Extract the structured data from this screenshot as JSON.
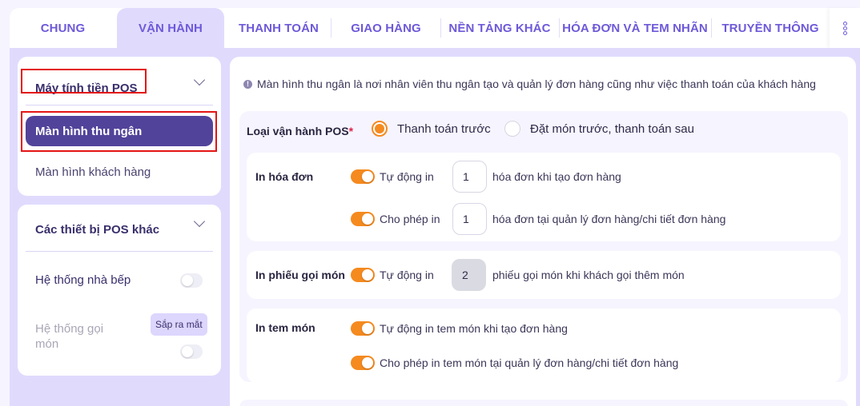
{
  "tabs": [
    {
      "label": "CHUNG",
      "active": false
    },
    {
      "label": "VẬN HÀNH",
      "active": true
    },
    {
      "label": "THANH TOÁN",
      "active": false
    },
    {
      "label": "GIAO HÀNG",
      "active": false
    },
    {
      "label": "NỀN TẢNG KHÁC",
      "active": false
    },
    {
      "label": "HÓA ĐƠN VÀ TEM NHÃN",
      "active": false
    },
    {
      "label": "TRUYỀN THÔNG",
      "active": false
    }
  ],
  "tabs_more_icon": "more-vertical-icon",
  "sidebar": {
    "group1": {
      "title": "Máy tính tiền POS",
      "items": [
        {
          "label": "Màn hình thu ngân",
          "active": true
        },
        {
          "label": "Màn hình khách hàng",
          "active": false
        }
      ]
    },
    "group2": {
      "title": "Các thiết bị POS khác",
      "items": [
        {
          "label": "Hệ thống nhà bếp",
          "toggle": false,
          "disabled": false
        },
        {
          "label": "Hệ thống gọi món",
          "toggle": false,
          "disabled": true,
          "badge": "Sắp ra mắt"
        }
      ]
    }
  },
  "content": {
    "info": "Màn hình thu ngân là nơi nhân viên thu ngân tạo và quản lý đơn hàng cũng như việc thanh toán của khách hàng",
    "pos_type": {
      "label": "Loại vận hành POS",
      "required_mark": "*",
      "options": [
        {
          "label": "Thanh toán trước",
          "selected": true
        },
        {
          "label": "Đặt món trước, thanh toán sau",
          "selected": false
        }
      ]
    },
    "print_invoice": {
      "label": "In hóa đơn",
      "rows": [
        {
          "toggle": true,
          "label": "Tự động in",
          "value": "1",
          "suffix": "hóa đơn khi tạo đơn hàng"
        },
        {
          "toggle": true,
          "label": "Cho phép in",
          "value": "1",
          "suffix": "hóa đơn tại quản lý đơn hàng/chi tiết đơn hàng"
        }
      ]
    },
    "print_order_ticket": {
      "label": "In phiếu gọi món",
      "rows": [
        {
          "toggle": true,
          "label": "Tự động in",
          "value": "2",
          "disabled": true,
          "suffix": "phiếu gọi món khi khách gọi thêm món"
        }
      ]
    },
    "print_item_label": {
      "label": "In tem món",
      "rows": [
        {
          "toggle": true,
          "label": "Tự động in tem món khi tạo đơn hàng"
        },
        {
          "toggle": true,
          "label": "Cho phép in tem món tại quản lý đơn hàng/chi tiết đơn hàng"
        }
      ]
    }
  },
  "colors": {
    "accent": "#6e59d9",
    "active_item": "#52439a",
    "toggle_on": "#f58a1f",
    "panel_bg": "#e0dbfd",
    "highlight_box": "#e41414"
  }
}
